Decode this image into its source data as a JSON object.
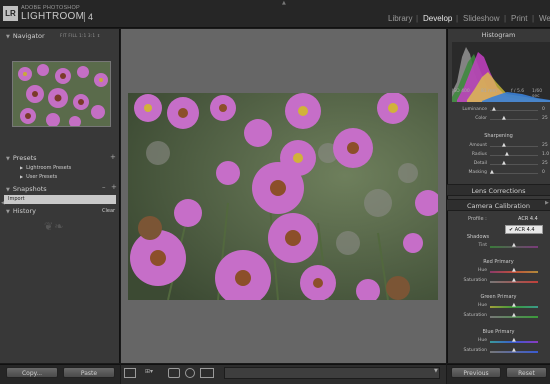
{
  "app": {
    "logo": "LR",
    "brand_small": "ADOBE PHOTOSHOP",
    "brand_big": "LIGHTROOM",
    "version": "4"
  },
  "modules": {
    "library": "Library",
    "develop": "Develop",
    "slideshow": "Slideshow",
    "print": "Print",
    "web": "We",
    "separator": "|",
    "active": "Develop"
  },
  "left_panel": {
    "navigator": {
      "title": "Navigator",
      "options": "FIT  FILL  1:1  3:1 ⇕"
    },
    "presets": {
      "title": "Presets",
      "add": "+",
      "items": [
        "Lightroom Presets",
        "User Presets"
      ]
    },
    "snapshots": {
      "title": "Snapshots",
      "minus": "–",
      "add": "+",
      "items": [
        "Import"
      ]
    },
    "history": {
      "title": "History",
      "clear": "Clear"
    },
    "copy_button": "Copy...",
    "paste_button": "Paste"
  },
  "right_panel": {
    "histogram": {
      "title": "Histogram",
      "iso": "ISO 400",
      "focal": "81 mm",
      "aperture": "f / 5.6",
      "shutter": "1/60 sec"
    },
    "basic_sliders": [
      {
        "label": "Luminance",
        "value": "0"
      },
      {
        "label": "Color",
        "value": "25"
      }
    ],
    "sharpening": {
      "title": "Sharpening",
      "sliders": [
        {
          "label": "Amount",
          "value": "25"
        },
        {
          "label": "Radius",
          "value": "1.0"
        },
        {
          "label": "Detail",
          "value": "25"
        },
        {
          "label": "Masking",
          "value": "0"
        }
      ]
    },
    "lens_corrections": "Lens Corrections",
    "camera_calibration": {
      "title": "Camera Calibration",
      "profile_label": "Profile :",
      "profile_value": "ACR 4.4",
      "profile_option": "✔ ACR 4.4",
      "shadows": {
        "title": "Shadows",
        "tint_label": "Tint"
      },
      "red": {
        "title": "Red Primary",
        "hue_label": "Hue",
        "sat_label": "Saturation"
      },
      "green": {
        "title": "Green Primary",
        "hue_label": "Hue",
        "sat_label": "Saturation"
      },
      "blue": {
        "title": "Blue Primary",
        "hue_label": "Hue",
        "sat_label": "Saturation"
      }
    },
    "previous_button": "Previous",
    "reset_button": "Reset"
  },
  "colors": {
    "background": "#1a1a1a",
    "panel": "#383838",
    "canvas": "#666666",
    "active_module": "#e8e8e8"
  }
}
